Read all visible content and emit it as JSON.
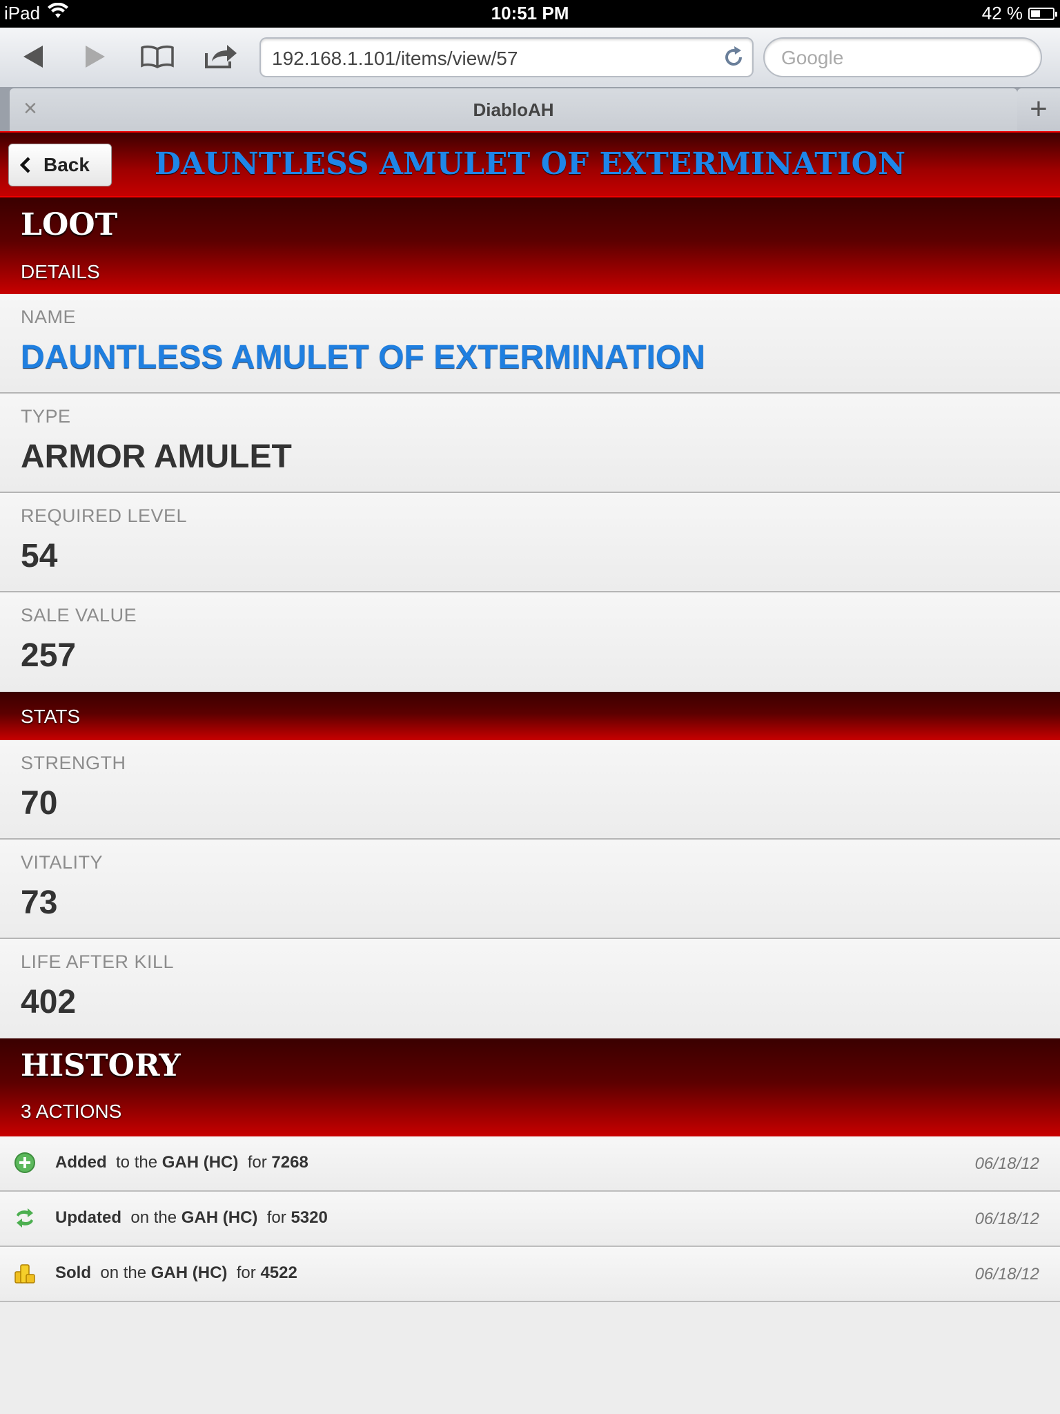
{
  "status_bar": {
    "device": "iPad",
    "time": "10:51 PM",
    "battery": "42 %",
    "battery_level": 0.42
  },
  "browser": {
    "url": "192.168.1.101/items/view/57",
    "search_placeholder": "Google",
    "tab_title": "DiabloAH",
    "tab_close": "×",
    "tab_new": "+"
  },
  "header": {
    "back_label": "Back",
    "title": "DAUNTLESS AMULET OF EXTERMINATION"
  },
  "loot": {
    "title": "LOOT",
    "subtitle": "DETAILS"
  },
  "details": [
    {
      "label": "NAME",
      "value": "DAUNTLESS AMULET OF EXTERMINATION"
    },
    {
      "label": "TYPE",
      "value": "ARMOR AMULET"
    },
    {
      "label": "REQUIRED LEVEL",
      "value": "54"
    },
    {
      "label": "SALE VALUE",
      "value": "257"
    }
  ],
  "stats_title": "STATS",
  "stats": [
    {
      "label": "STRENGTH",
      "value": "70"
    },
    {
      "label": "VITALITY",
      "value": "73"
    },
    {
      "label": "LIFE AFTER KILL",
      "value": "402"
    }
  ],
  "history": {
    "title": "HISTORY",
    "subtitle": "3 ACTIONS",
    "items": [
      {
        "icon": "add-icon",
        "action": "Added",
        "prep": "to the",
        "house": "GAH (HC)",
        "for_word": "for",
        "amount": "7268",
        "date": "06/18/12"
      },
      {
        "icon": "update-icon",
        "action": "Updated",
        "prep": "on the",
        "house": "GAH (HC)",
        "for_word": "for",
        "amount": "5320",
        "date": "06/18/12"
      },
      {
        "icon": "gold-coins-icon",
        "action": "Sold",
        "prep": "on the",
        "house": "GAH (HC)",
        "for_word": "for",
        "amount": "4522",
        "date": "06/18/12"
      }
    ]
  }
}
